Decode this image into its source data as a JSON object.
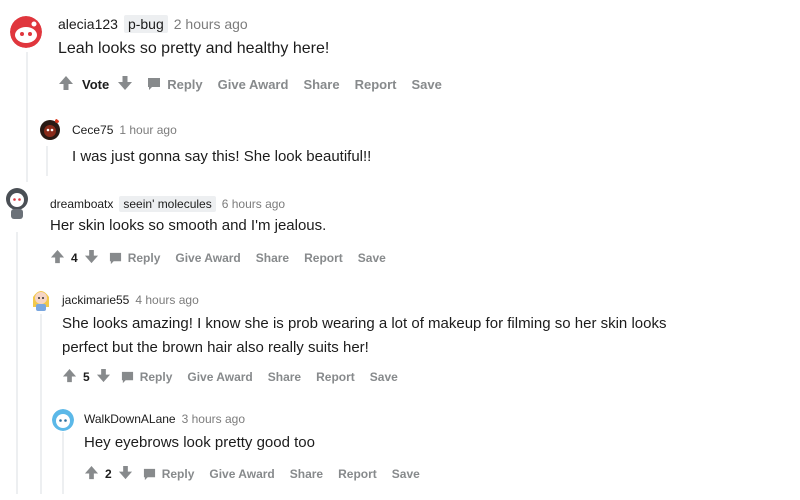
{
  "comments": [
    {
      "username": "alecia123",
      "flair": "p-bug",
      "time": "2 hours ago",
      "text": "Leah looks so pretty and healthy here!",
      "vote": "Vote",
      "actions": [
        "Reply",
        "Give Award",
        "Share",
        "Report",
        "Save"
      ]
    },
    {
      "username": "Cece75",
      "time": "1 hour ago",
      "text": "I was just gonna say this! She look beautiful!!"
    },
    {
      "username": "dreamboatx",
      "flair": "seein' molecules",
      "time": "6 hours ago",
      "text": "Her skin looks so smooth and I'm jealous.",
      "vote": "4",
      "actions": [
        "Reply",
        "Give Award",
        "Share",
        "Report",
        "Save"
      ]
    },
    {
      "username": "jackimarie55",
      "time": "4 hours ago",
      "text_lines": [
        "She looks amazing! I know she is prob wearing a lot of makeup for filming so her skin looks",
        "perfect but the brown hair also really suits her!"
      ],
      "vote": "5",
      "actions": [
        "Reply",
        "Give Award",
        "Share",
        "Report",
        "Save"
      ]
    },
    {
      "username": "WalkDownALane",
      "time": "3 hours ago",
      "text": "Hey eyebrows look pretty good too",
      "vote": "2",
      "actions": [
        "Reply",
        "Give Award",
        "Share",
        "Report",
        "Save"
      ]
    }
  ],
  "icons": {
    "upvote": "arrow-up-icon",
    "downvote": "arrow-down-icon",
    "reply": "comment-bubble-icon"
  },
  "colors": {
    "muted": "#878a8c",
    "flair_bg": "#edeff1",
    "thread_line": "#edeff1"
  }
}
